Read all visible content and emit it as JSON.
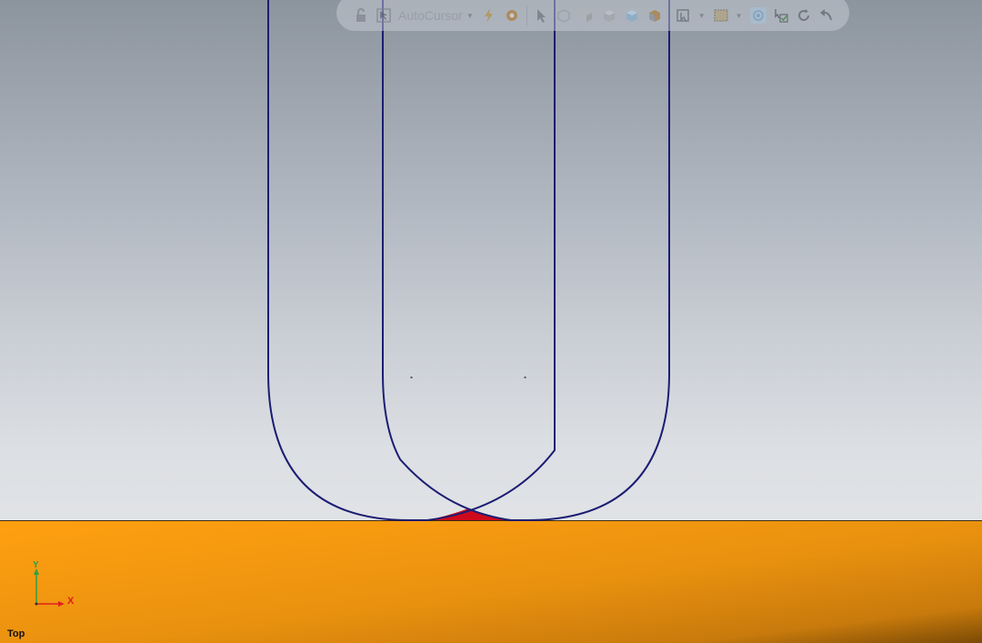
{
  "toolbar": {
    "autocursor_label": "AutoCursor",
    "icons": [
      "lock-icon",
      "autocursor-icon",
      "lightning-icon",
      "gear-icon",
      "select-arrow-icon",
      "box-wireframe-icon",
      "box-shaded-icon",
      "box-solid-icon",
      "box-blue-icon",
      "box-orange-icon",
      "selection-filter-icon",
      "box-select-icon",
      "view-normal-icon",
      "select-check-icon",
      "rotate-icon",
      "undo-view-icon"
    ]
  },
  "viewport": {
    "view_name": "Top",
    "axis_x_label": "X",
    "axis_y_label": "Y"
  },
  "colors": {
    "curve": "#1c1d72",
    "ground": "#f39a10",
    "intersection": "#cc0a1c",
    "axis_x": "#e02020",
    "axis_y": "#2aa14a"
  }
}
